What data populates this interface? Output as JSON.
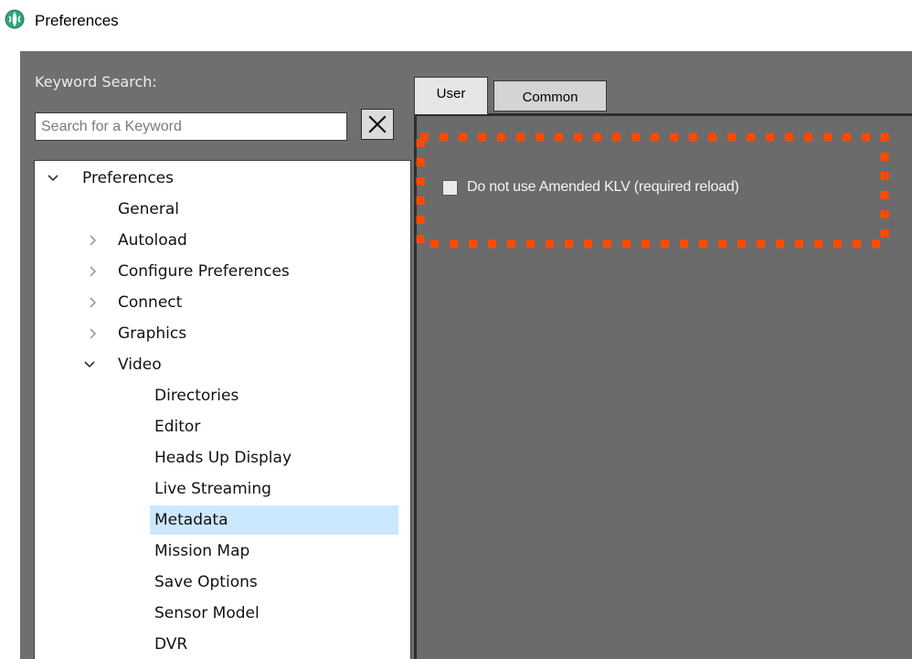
{
  "window": {
    "title": "Preferences",
    "icon": "app-logo-icon",
    "colors": {
      "frame": "#6f6f6f",
      "selection": "#cce8ff",
      "highlight_border": "#ff4a00"
    }
  },
  "search": {
    "label": "Keyword Search:",
    "placeholder": "Search for a Keyword",
    "value": "",
    "clear_icon": "close-icon"
  },
  "tabs": [
    {
      "label": "User",
      "active": true
    },
    {
      "label": "Common",
      "active": false
    }
  ],
  "tree": [
    {
      "label": "Preferences",
      "depth": 0,
      "chevron": "expanded"
    },
    {
      "label": "General",
      "depth": 1,
      "chevron": "none"
    },
    {
      "label": "Autoload",
      "depth": 1,
      "chevron": "collapsed"
    },
    {
      "label": "Configure Preferences",
      "depth": 1,
      "chevron": "collapsed"
    },
    {
      "label": "Connect",
      "depth": 1,
      "chevron": "collapsed"
    },
    {
      "label": "Graphics",
      "depth": 1,
      "chevron": "collapsed"
    },
    {
      "label": "Video",
      "depth": 1,
      "chevron": "expanded"
    },
    {
      "label": "Directories",
      "depth": 2,
      "chevron": "none"
    },
    {
      "label": "Editor",
      "depth": 2,
      "chevron": "none"
    },
    {
      "label": "Heads Up Display",
      "depth": 2,
      "chevron": "none"
    },
    {
      "label": "Live Streaming",
      "depth": 2,
      "chevron": "none"
    },
    {
      "label": "Metadata",
      "depth": 2,
      "chevron": "none",
      "selected": true
    },
    {
      "label": "Mission Map",
      "depth": 2,
      "chevron": "none"
    },
    {
      "label": "Save Options",
      "depth": 2,
      "chevron": "none"
    },
    {
      "label": "Sensor Model",
      "depth": 2,
      "chevron": "none"
    },
    {
      "label": "DVR",
      "depth": 2,
      "chevron": "none"
    }
  ],
  "options": [
    {
      "label": "Do not use Amended KLV (required reload)",
      "checked": false,
      "highlighted": true
    }
  ]
}
